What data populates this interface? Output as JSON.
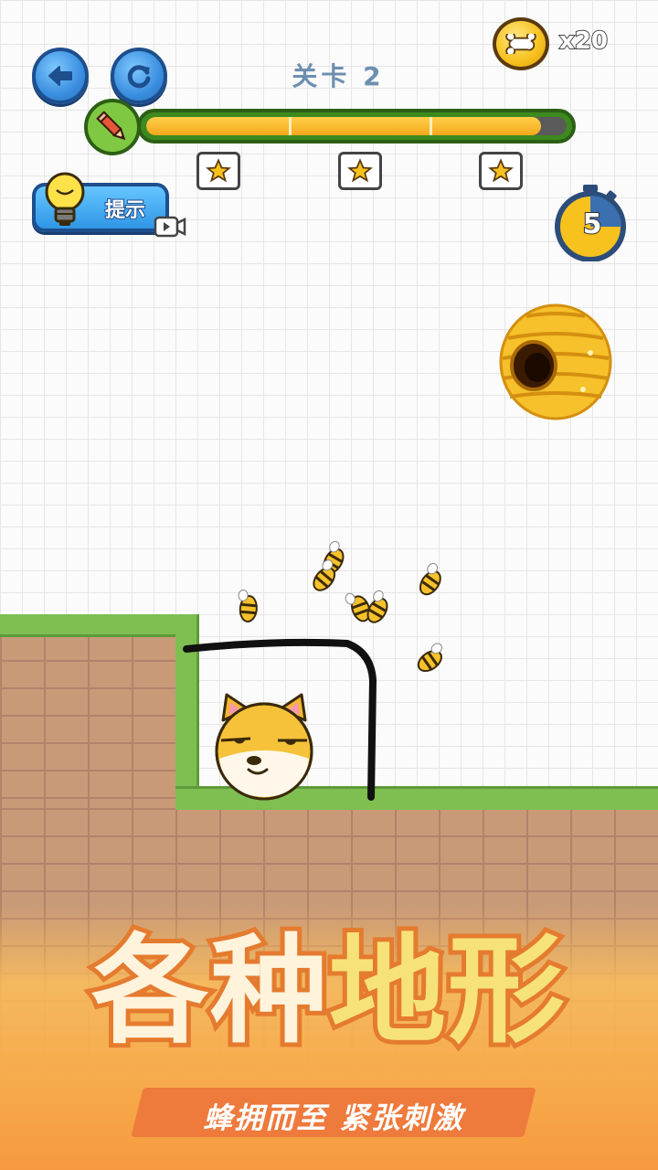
{
  "header": {
    "level_title": "关卡 2",
    "coin_count": "x20",
    "back_icon": "arrow-left-icon",
    "restart_icon": "refresh-icon",
    "coin_icon": "bone-coin-icon"
  },
  "progress": {
    "fraction": 0.94,
    "star_thresholds": 3,
    "pencil_icon": "pencil-icon",
    "star_icon": "star-icon"
  },
  "hint": {
    "label": "提示",
    "icon": "lightbulb-icon",
    "badge_icon": "video-ad-icon"
  },
  "timer": {
    "seconds": "5",
    "icon": "stopwatch-icon"
  },
  "scene": {
    "hive_icon": "beehive-icon",
    "bee_icon": "bee-icon",
    "character": "shiba-dog-icon"
  },
  "banner": {
    "title_part1": "各种",
    "title_part2": "地形",
    "subtitle": "蜂拥而至 紧张刺激"
  },
  "colors": {
    "button_blue": "#3b8fe0",
    "grass_green": "#7fbf52",
    "brick": "#c99a78",
    "progress_fill": "#f5a81c",
    "banner_orange": "#f59a3e"
  }
}
